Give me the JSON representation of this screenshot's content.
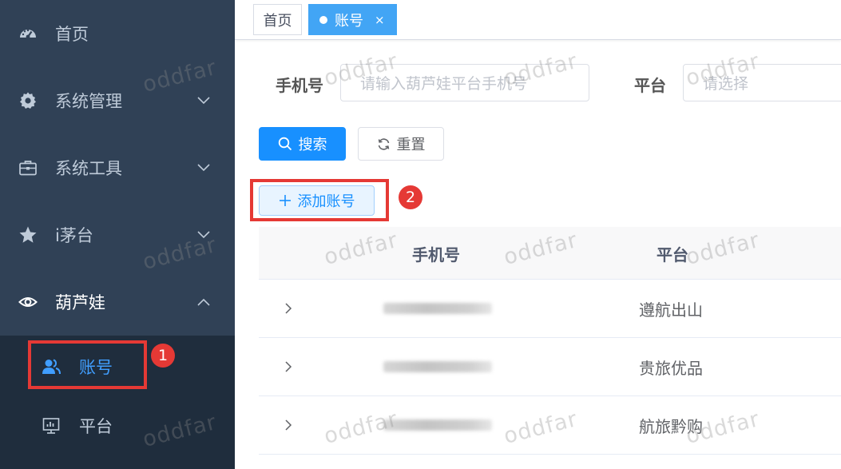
{
  "sidebar": {
    "items": [
      {
        "label": "首页",
        "icon": "dashboard-icon"
      },
      {
        "label": "系统管理",
        "icon": "gear-icon"
      },
      {
        "label": "系统工具",
        "icon": "toolbox-icon"
      },
      {
        "label": "i茅台",
        "icon": "star-icon"
      },
      {
        "label": "葫芦娃",
        "icon": "eye-icon"
      }
    ],
    "subitems": [
      {
        "label": "账号",
        "icon": "user-group-icon",
        "active": true
      },
      {
        "label": "平台",
        "icon": "monitor-chart-icon",
        "active": false
      }
    ]
  },
  "tabs": {
    "home": "首页",
    "account": "账号",
    "close": "×"
  },
  "search": {
    "phone_label": "手机号",
    "phone_placeholder": "请输入葫芦娃平台手机号",
    "platform_label": "平台",
    "platform_placeholder": "请选择",
    "search_button": "搜索",
    "reset_button": "重置"
  },
  "actions": {
    "add_account": "添加账号"
  },
  "annotations": [
    "1",
    "2"
  ],
  "table": {
    "headers": [
      "手机号",
      "平台"
    ],
    "rows": [
      {
        "phone": "",
        "platform": "遵航出山"
      },
      {
        "phone": "",
        "platform": "贵旅优品"
      },
      {
        "phone": "",
        "platform": "航旅黔购"
      }
    ]
  },
  "watermark": "oddfar",
  "colors": {
    "sidebar_bg": "#304156",
    "submenu_bg": "#1f2d3d",
    "accent": "#1890ff",
    "active_tab": "#42a5f5",
    "annotation_red": "#e53935"
  }
}
